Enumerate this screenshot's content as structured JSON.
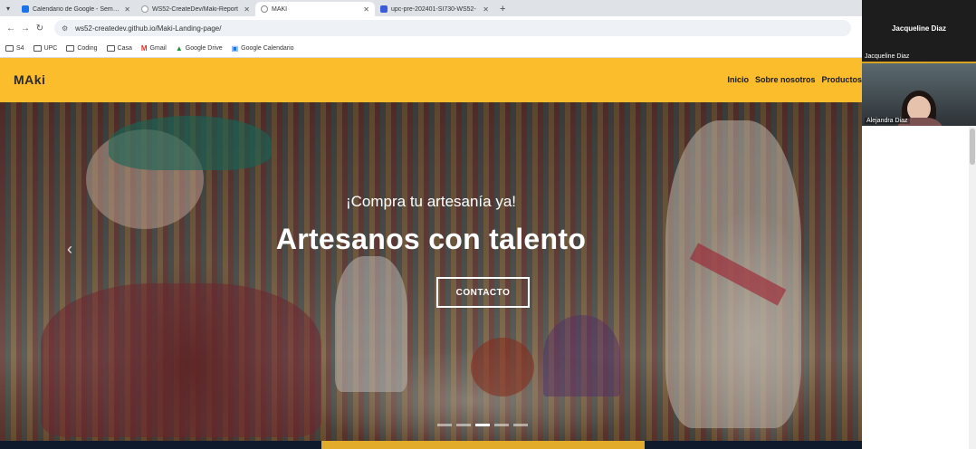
{
  "browser": {
    "tabs": [
      {
        "title": "Calendario de Google - Semana",
        "color": "#1a73e8"
      },
      {
        "title": "WS52-CreateDev/Maki-Report",
        "color": "#ffffff"
      },
      {
        "title": "MAKI",
        "color": "#888888"
      },
      {
        "title": "upc-pre-202401-SI730-WS52-",
        "color": "#3b5bdb"
      }
    ],
    "new_tab": "+",
    "url": "ws52-createdev.github.io/Maki-Landing-page/",
    "bookmarks": [
      {
        "label": "S4",
        "icon": "folder-icon"
      },
      {
        "label": "UPC",
        "icon": "folder-icon"
      },
      {
        "label": "Coding",
        "icon": "folder-icon"
      },
      {
        "label": "Casa",
        "icon": "folder-icon"
      },
      {
        "label": "Gmail",
        "icon": "gmail-icon"
      },
      {
        "label": "Google Drive",
        "icon": "drive-icon"
      },
      {
        "label": "Google Calendario",
        "icon": "calendar-icon"
      }
    ]
  },
  "site": {
    "logo": "MAki",
    "nav": [
      "Inicio",
      "Sobre nosotros",
      "Productos"
    ],
    "hero": {
      "subtitle": "¡Compra tu artesanía ya!",
      "title": "Artesanos con talento",
      "button": "CONTACTO",
      "prev": "‹",
      "next": "›",
      "slides": 5,
      "active_slide": 3
    }
  },
  "meeting": {
    "participant1": {
      "name": "Jacqueline Diaz",
      "label": "Jacqueline Diaz"
    },
    "participant2": {
      "label": "Alejandra Diaz"
    }
  }
}
